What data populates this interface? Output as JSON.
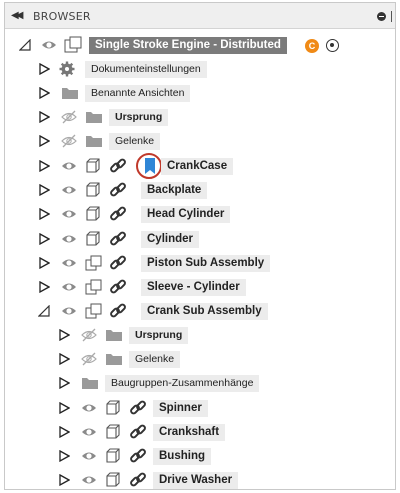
{
  "header": {
    "title": "BROWSER",
    "collapse_icon": "double-chevron-left-icon"
  },
  "root": {
    "label": "Single Stroke Engine - Distributed",
    "badge": "C",
    "badge_color": "#f08a16"
  },
  "items": [
    {
      "label": "Dokumenteinstellungen",
      "kind": "settings"
    },
    {
      "label": "Benannte Ansichten",
      "kind": "folder"
    },
    {
      "label": "Ursprung",
      "kind": "folder-hidden"
    },
    {
      "label": "Gelenke",
      "kind": "folder-hidden"
    },
    {
      "label": "CrankCase",
      "kind": "component-active"
    },
    {
      "label": "Backplate",
      "kind": "component"
    },
    {
      "label": "Head Cylinder",
      "kind": "component"
    },
    {
      "label": "Cylinder",
      "kind": "component"
    },
    {
      "label": "Piston Sub Assembly",
      "kind": "assembly"
    },
    {
      "label": "Sleeve - Cylinder",
      "kind": "assembly"
    },
    {
      "label": "Crank Sub Assembly",
      "kind": "assembly-open"
    },
    {
      "label": "Ursprung",
      "kind": "sub-folder-hidden"
    },
    {
      "label": "Gelenke",
      "kind": "sub-folder-hidden"
    },
    {
      "label": "Baugruppen-Zusammenhänge",
      "kind": "sub-folder"
    },
    {
      "label": "Spinner",
      "kind": "sub-component"
    },
    {
      "label": "Crankshaft",
      "kind": "sub-component"
    },
    {
      "label": "Bushing",
      "kind": "sub-component"
    },
    {
      "label": "Drive Washer",
      "kind": "sub-component"
    }
  ]
}
